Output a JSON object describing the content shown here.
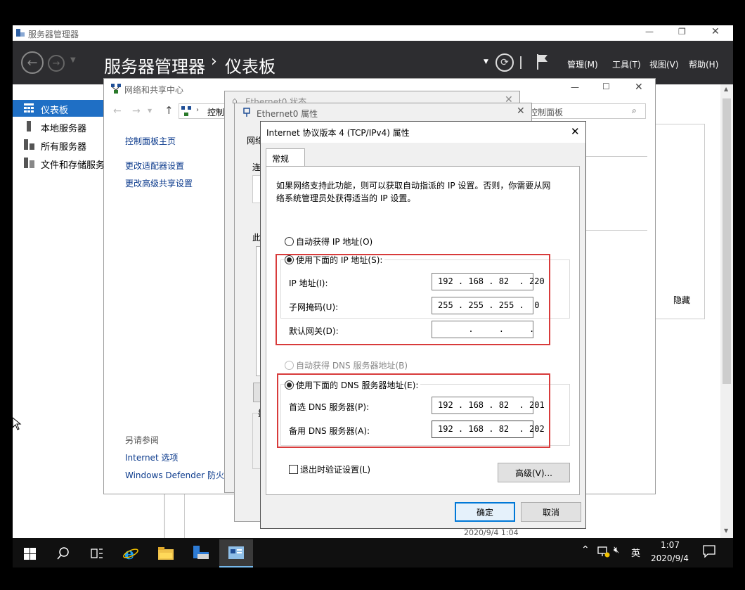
{
  "server_manager": {
    "title": "服务器管理器",
    "header_app": "服务器管理器",
    "header_sep": "›",
    "header_page": "仪表板",
    "menu": [
      "管理(M)",
      "工具(T)",
      "视图(V)",
      "帮助(H)"
    ],
    "sidebar": [
      "仪表板",
      "本地服务器",
      "所有服务器",
      "文件和存储服务"
    ],
    "hide_label": "隐藏",
    "timestamp": "2020/9/4 1:04"
  },
  "network_center": {
    "title": "网络和共享中心",
    "address": "控制",
    "search_placeholder": "控制面板",
    "home_link": "控制面板主页",
    "links": [
      "更改适配器设置",
      "更改高级共享设置"
    ],
    "see_also": "另请参阅",
    "see_also_links": [
      "Internet 选项",
      "Windows Defender 防火墙"
    ]
  },
  "eth_status": {
    "title": "Ethernet0 状态"
  },
  "eth_props": {
    "title": "Ethernet0 属性",
    "tab": "网络",
    "conn_label": "连",
    "this_label": "此",
    "desc_label": "描"
  },
  "ipv4": {
    "title": "Internet 协议版本 4 (TCP/IPv4) 属性",
    "tab": "常规",
    "desc_line1": "如果网络支持此功能，则可以获取自动指派的 IP 设置。否则，你需要从网",
    "desc_line2": "络系统管理员处获得适当的 IP 设置。",
    "auto_ip": "自动获得 IP 地址(O)",
    "manual_ip": "使用下面的 IP 地址(S):",
    "ip_label": "IP 地址(I):",
    "ip_value": "192 . 168 . 82  . 220",
    "mask_label": "子网掩码(U):",
    "mask_value": "255 . 255 . 255 .  0",
    "gateway_label": "默认网关(D):",
    "gateway_value": "      .     .     .",
    "auto_dns": "自动获得 DNS 服务器地址(B)",
    "manual_dns": "使用下面的 DNS 服务器地址(E):",
    "dns1_label": "首选 DNS 服务器(P):",
    "dns1_value": "192 . 168 . 82  . 201",
    "dns2_label": "备用 DNS 服务器(A):",
    "dns2_value": "192 . 168 . 82  . 202",
    "validate_label": "退出时验证设置(L)",
    "advanced_button": "高级(V)...",
    "ok_button": "确定",
    "cancel_button": "取消"
  },
  "taskbar": {
    "time": "1:07",
    "date": "2020/9/4",
    "ime": "英"
  }
}
